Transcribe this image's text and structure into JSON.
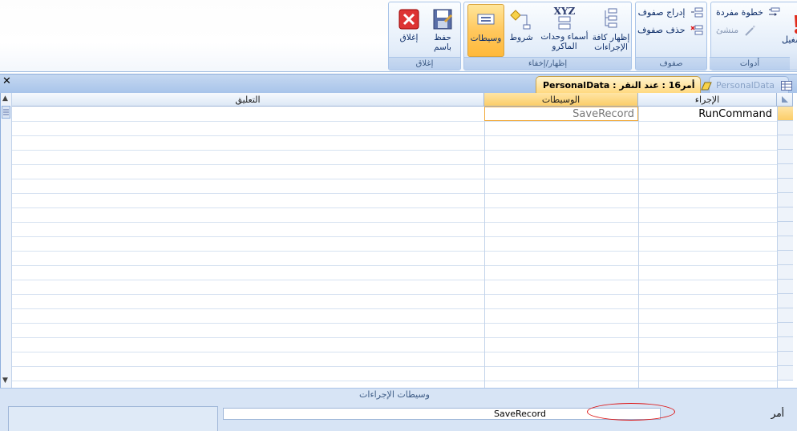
{
  "ribbon": {
    "groups": {
      "close": {
        "label": "إغلاق",
        "save_as": "حفظ\nباسم",
        "close": "إغلاق"
      },
      "show_hide": {
        "label": "إظهار/إخفاء",
        "show_all": "إظهار كافة الإجراءات",
        "macro_names": "أسماء وحدات الماكرو",
        "conditions": "شروط",
        "arguments": "وسيطات",
        "xyz": "XYZ"
      },
      "rows": {
        "label": "صفوف",
        "insert_rows": "إدراج صفوف",
        "delete_rows": "حذف صفوف"
      },
      "tools": {
        "label": "أدوات",
        "single_step": "خطوة مفردة",
        "builder": "منشئ",
        "run": "تشغيل"
      }
    }
  },
  "tabs": [
    {
      "label": "PersonalData"
    },
    {
      "label": "PersonalData : أمر16 : عند النقر"
    }
  ],
  "grid": {
    "columns": [
      "الإجراء",
      "الوسيطات",
      "التعليق"
    ],
    "rows": [
      {
        "action": "RunCommand",
        "arguments": "SaveRecord",
        "comment": ""
      }
    ]
  },
  "bottom": {
    "title": "وسيطات الإجراءات",
    "arg_label": "أمر",
    "arg_value": "SaveRecord"
  },
  "colors": {
    "accent": "#ffc85e",
    "ribbon_border": "#a9c4e8",
    "highlight_oval": "#dd1111"
  }
}
